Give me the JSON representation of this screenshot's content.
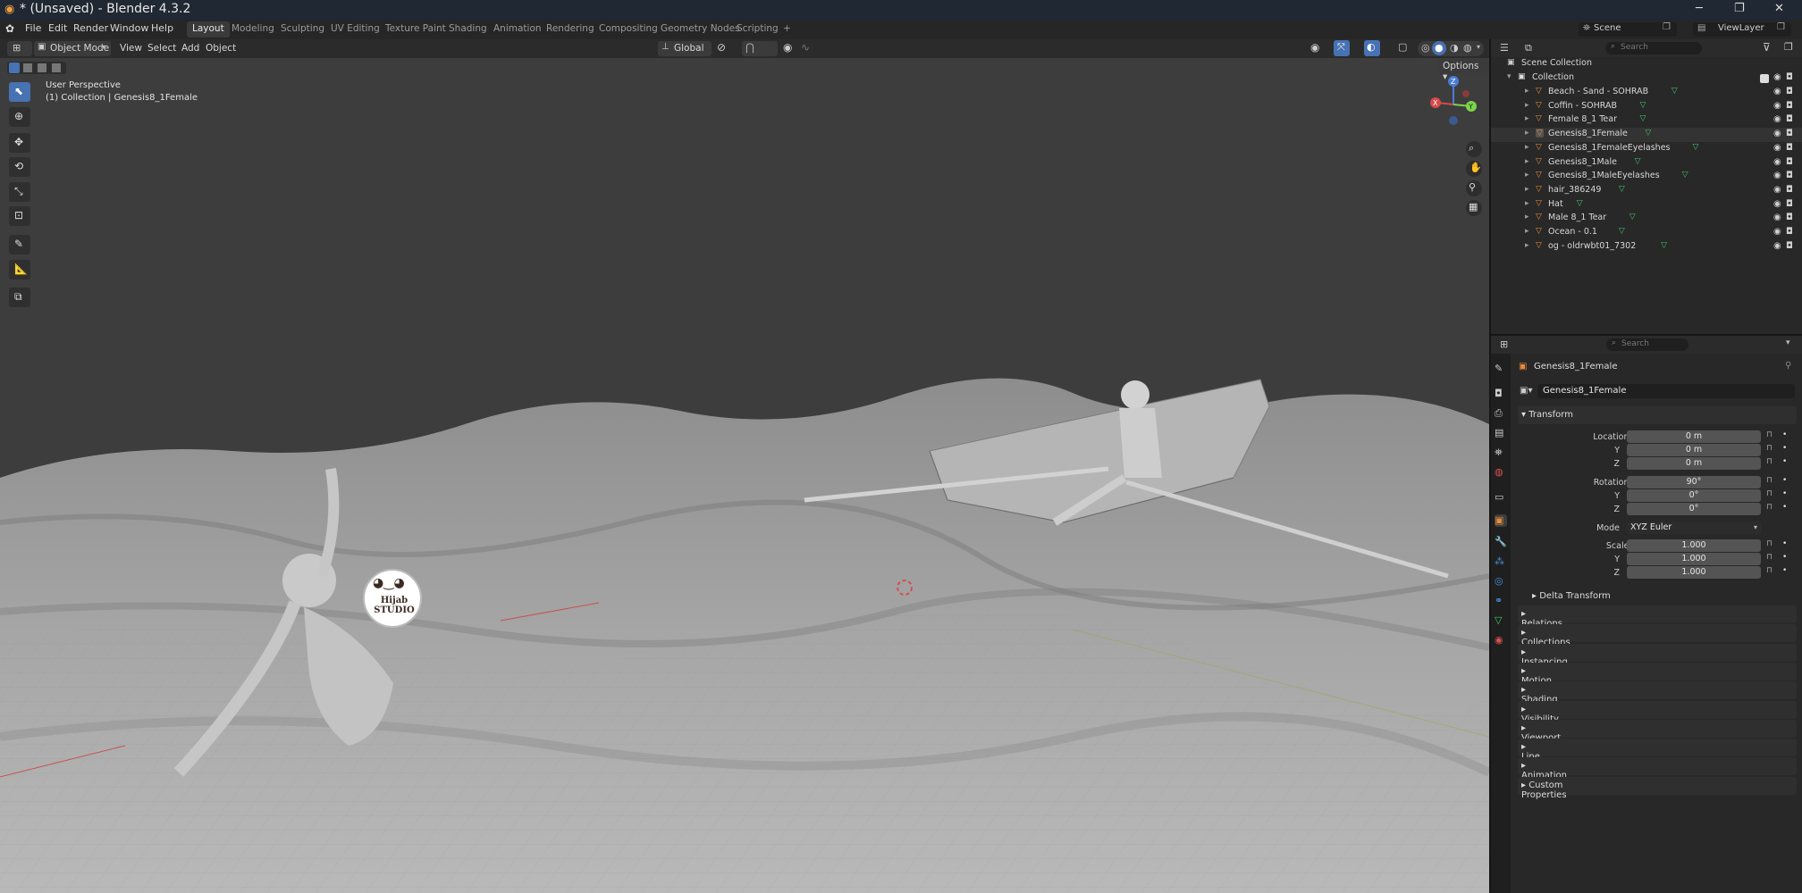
{
  "window": {
    "title": "* (Unsaved) - Blender 4.3.2"
  },
  "menu": [
    "File",
    "Edit",
    "Render",
    "Window",
    "Help"
  ],
  "workspaces": [
    "Layout",
    "Modeling",
    "Sculpting",
    "UV Editing",
    "Texture Paint",
    "Shading",
    "Animation",
    "Rendering",
    "Compositing",
    "Geometry Nodes",
    "Scripting"
  ],
  "workspace_add": "+",
  "scene": {
    "name": "Scene",
    "view_layer": "ViewLayer"
  },
  "viewport_header": {
    "mode": "Object Mode",
    "menus": [
      "View",
      "Select",
      "Add",
      "Object"
    ],
    "orientation": "Global",
    "options": "Options"
  },
  "viewport_overlay": {
    "perspective": "User Perspective",
    "collection_info": "(1) Collection | Genesis8_1Female"
  },
  "gizmo": {
    "x": "X",
    "y": "Y",
    "z": "Z"
  },
  "watermark": "Hijab STUDIO",
  "outliner": {
    "search_placeholder": "Search",
    "scene_collection": "Scene Collection",
    "collection": "Collection",
    "items": [
      "Beach - Sand - SOHRAB",
      "Coffin - SOHRAB",
      "Female 8_1 Tear",
      "Genesis8_1Female",
      "Genesis8_1FemaleEyelashes",
      "Genesis8_1Male",
      "Genesis8_1MaleEyelashes",
      "hair_386249",
      "Hat",
      "Male 8_1 Tear",
      "Ocean - 0.1",
      "og - oldrwbt01_7302"
    ]
  },
  "properties": {
    "search_placeholder": "Search",
    "object_name": "Genesis8_1Female",
    "object_field": "Genesis8_1Female",
    "transform_title": "Transform",
    "location": {
      "label": "Location X",
      "x": "0 m",
      "y": "0 m",
      "z": "0 m"
    },
    "rotation": {
      "label": "Rotation X",
      "x": "90°",
      "y": "0°",
      "z": "0°"
    },
    "mode": {
      "label": "Mode",
      "value": "XYZ Euler"
    },
    "scale": {
      "label": "Scale X",
      "x": "1.000",
      "y": "1.000",
      "z": "1.000"
    },
    "axis_y": "Y",
    "axis_z": "Z",
    "delta_transform": "Delta Transform",
    "sections": [
      "Relations",
      "Collections",
      "Instancing",
      "Motion Paths",
      "Shading",
      "Visibility",
      "Viewport Display",
      "Line Art",
      "Animation",
      "Custom Properties"
    ]
  },
  "colors": {
    "accent": "#4772b3",
    "object_orange": "#e88a3b",
    "mesh_green": "#46c26b"
  }
}
